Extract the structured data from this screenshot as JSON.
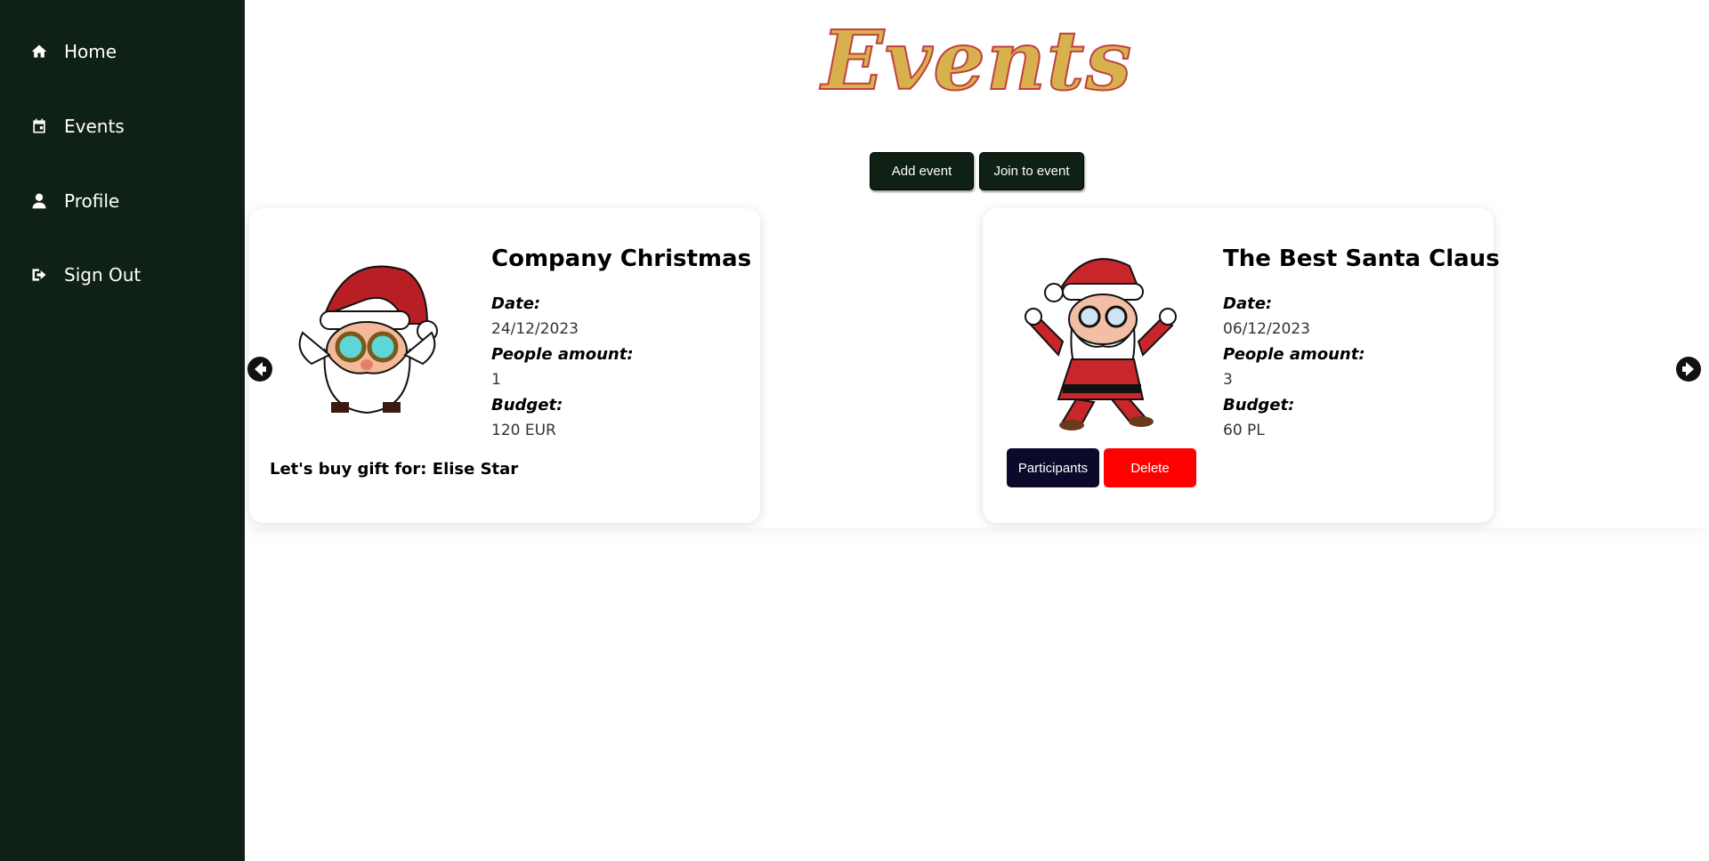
{
  "sidebar": {
    "items": [
      {
        "label": "Home",
        "icon": "home-icon"
      },
      {
        "label": "Events",
        "icon": "calendar-icon"
      },
      {
        "label": "Profile",
        "icon": "user-icon"
      },
      {
        "label": "Sign Out",
        "icon": "sign-out-icon"
      }
    ]
  },
  "page": {
    "title": "Events",
    "add_event_label": "Add event",
    "join_event_label": "Join to event"
  },
  "events": [
    {
      "title": "Company Christmas",
      "date_label": "Date:",
      "date": "24/12/2023",
      "people_label": "People amount:",
      "people": "1",
      "budget_label": "Budget:",
      "budget": "120 EUR",
      "gift_text": "Let's buy gift for: Elise Star",
      "image": "santa-with-goggles-image"
    },
    {
      "title": "The Best Santa Claus",
      "date_label": "Date:",
      "date": "06/12/2023",
      "people_label": "People amount:",
      "people": "3",
      "budget_label": "Budget:",
      "budget": "60 PL",
      "participants_label": "Participants",
      "delete_label": "Delete",
      "image": "santa-dancing-image"
    }
  ],
  "carousel": {
    "prev_icon": "arrow-left-circle-icon",
    "next_icon": "arrow-right-circle-icon"
  },
  "colors": {
    "sidebar_bg": "#0f2015",
    "title_fill": "#d6b14e",
    "title_stroke": "#c2403f",
    "participants_bg": "#0c0a2b",
    "delete_bg": "#ff0000"
  }
}
